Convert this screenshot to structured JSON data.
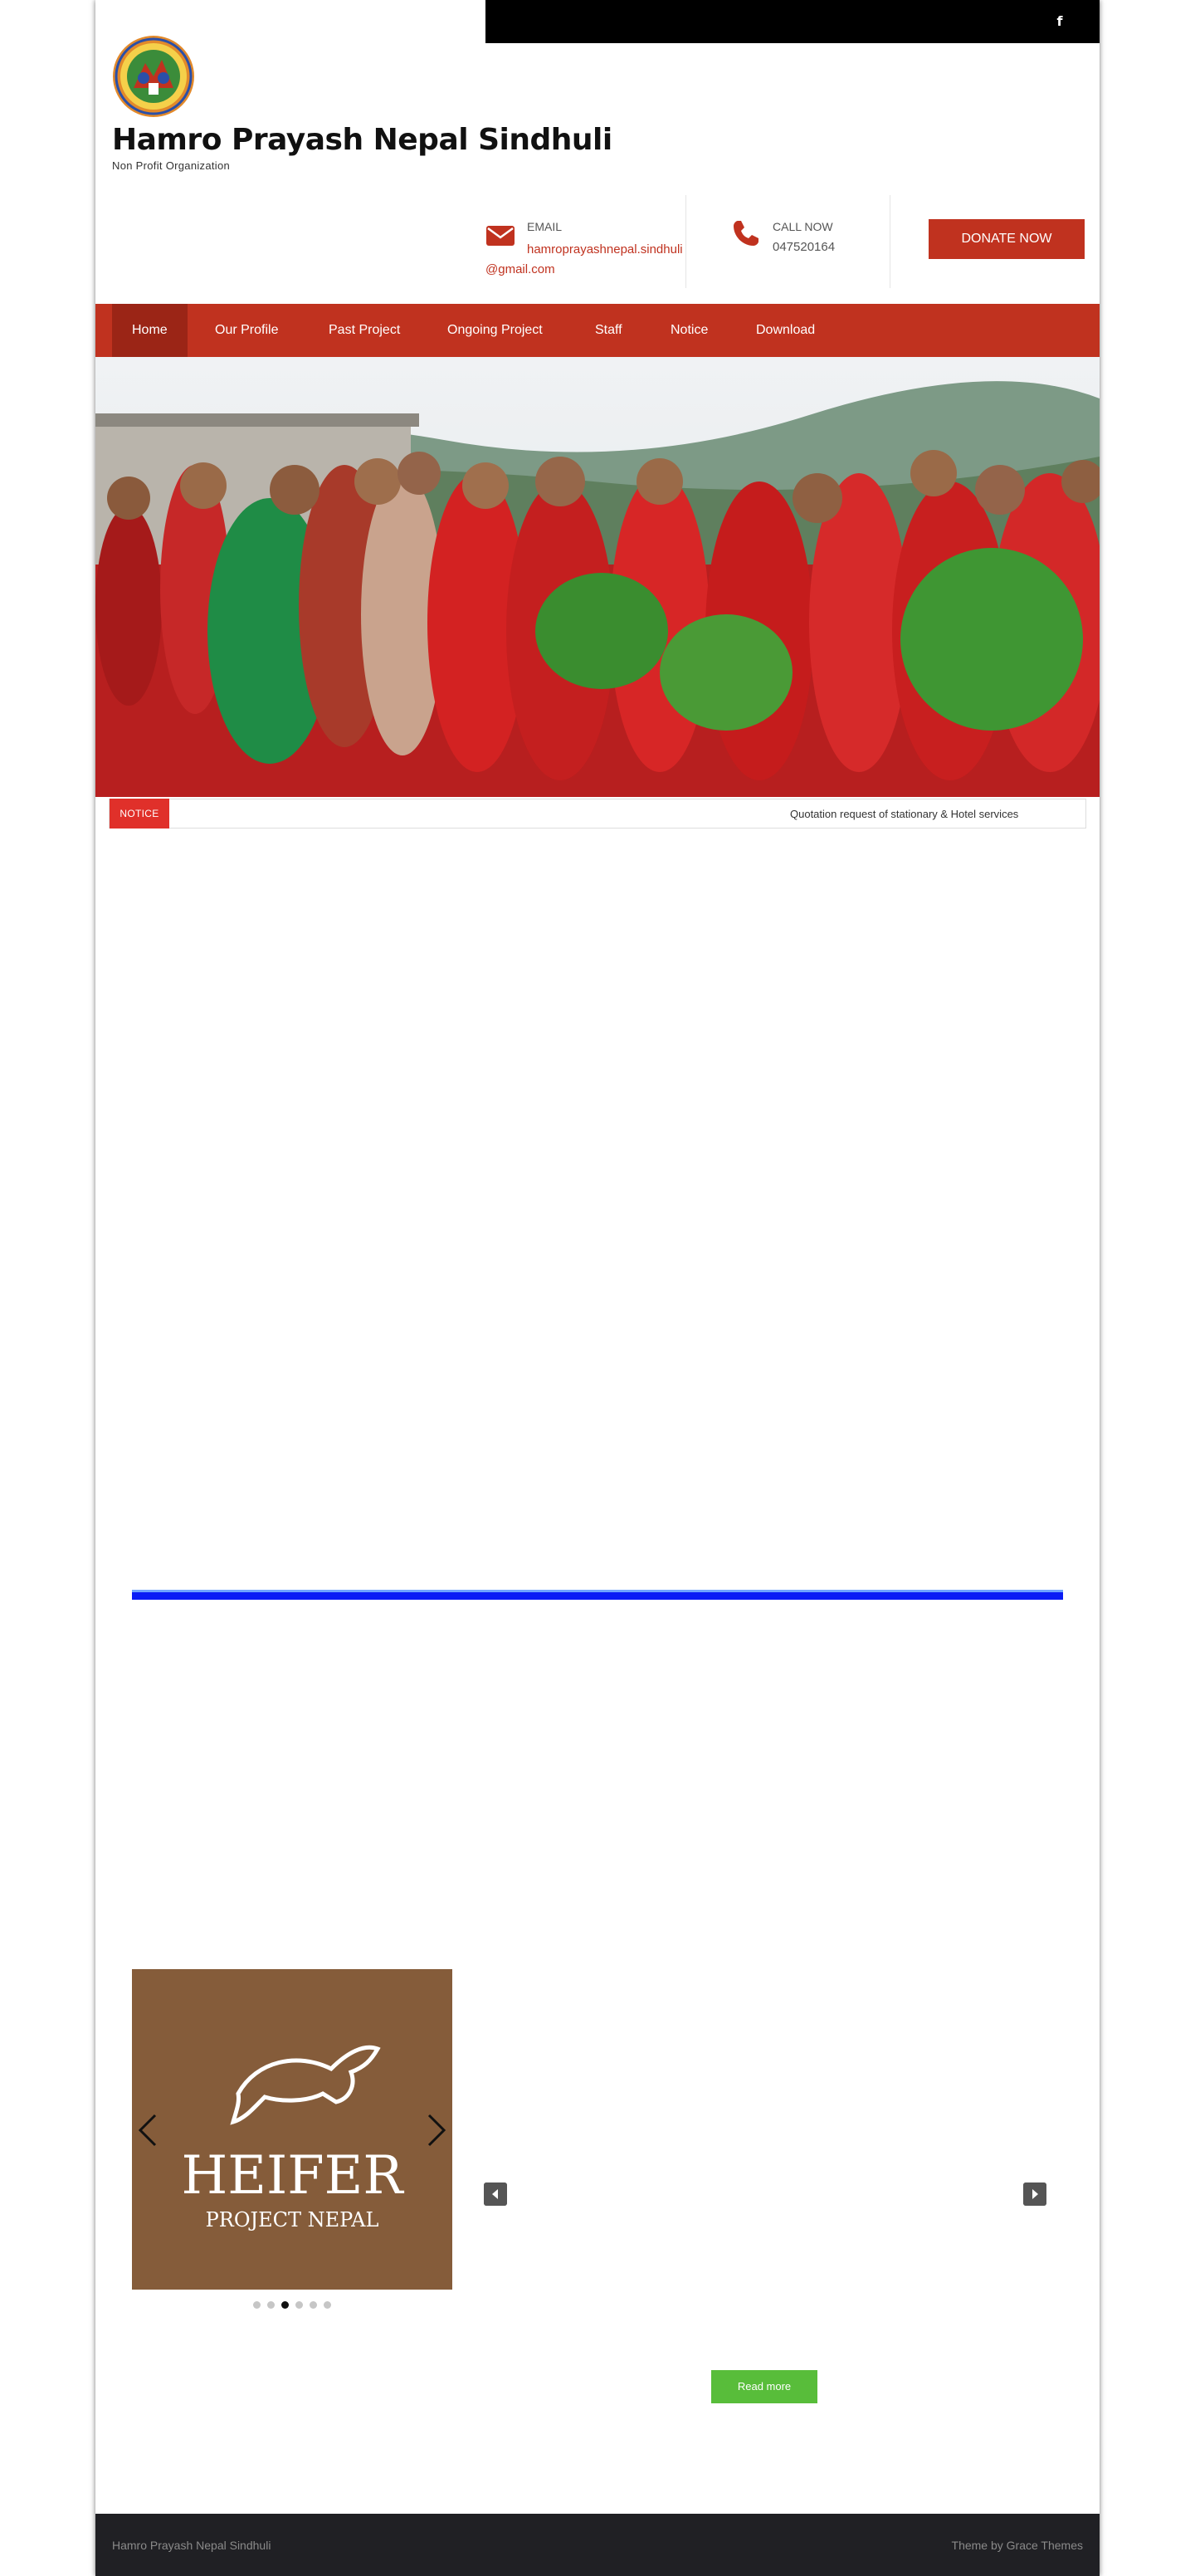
{
  "topbar": {
    "facebook_icon": "facebook-icon",
    "facebook_glyph": "f"
  },
  "header": {
    "site_title": "Hamro Prayash Nepal Sindhuli",
    "tagline": "Non Profit Organization",
    "email": {
      "label": "EMAIL",
      "value": "hamroprayashnepal.sindhuli@gmail.com",
      "icon": "envelope-icon"
    },
    "call": {
      "label": "CALL NOW",
      "value": "047520164",
      "icon": "phone-icon"
    },
    "donate_label": "DONATE NOW"
  },
  "nav": {
    "items": [
      {
        "label": "Home",
        "active": true
      },
      {
        "label": "Our Profile"
      },
      {
        "label": "Past Project"
      },
      {
        "label": "Ongoing Project"
      },
      {
        "label": "Staff"
      },
      {
        "label": "Notice"
      },
      {
        "label": "Download"
      }
    ]
  },
  "notice": {
    "tag": "NOTICE",
    "text": "Quotation request of stationary & Hotel services"
  },
  "partners": {
    "logo_text": "HEIFER",
    "logo_subtext": "PROJECT NEPAL",
    "dot_count": 6,
    "active_dot": 3
  },
  "readmore_label": "Read more",
  "footer": {
    "left": "Hamro Prayash Nepal Sindhuli",
    "right": "Theme by Grace Themes"
  },
  "colors": {
    "brand_red": "#c0321f",
    "nav_active": "#9b2516",
    "notice_red": "#e0302a",
    "readmore_green": "#58bd3a",
    "footer_bg": "#202024",
    "separator_blue": "#0a1cf5"
  }
}
